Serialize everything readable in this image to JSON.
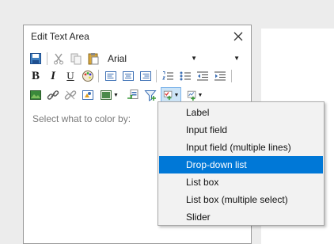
{
  "dialog": {
    "title": "Edit Text Area",
    "font_name": "Arial",
    "font_size": "",
    "hint": "Select what to color by:"
  },
  "toolbar": {
    "row1": [
      "save-icon",
      "cut-icon",
      "copy-icon",
      "paste-icon"
    ],
    "row2": [
      "bold-icon",
      "italic-icon",
      "underline-icon",
      "color-palette-icon",
      "align-left-icon",
      "align-center-icon",
      "align-right-icon",
      "numbered-list-icon",
      "bullet-list-icon",
      "outdent-icon",
      "indent-icon"
    ],
    "row3": [
      "insert-image-icon",
      "insert-link-icon",
      "remove-link-icon",
      "insert-property-icon",
      "insert-visualization-icon",
      "insert-action-icon",
      "insert-filter-icon",
      "insert-property-control-icon",
      "insert-dynamic-item-icon"
    ]
  },
  "menu": {
    "items": [
      "Label",
      "Input field",
      "Input field (multiple lines)",
      "Drop-down list",
      "List box",
      "List box (multiple select)",
      "Slider"
    ],
    "selected_index": 3
  },
  "colors": {
    "accent": "#0078d7",
    "menu_bg": "#f2f2f2"
  }
}
